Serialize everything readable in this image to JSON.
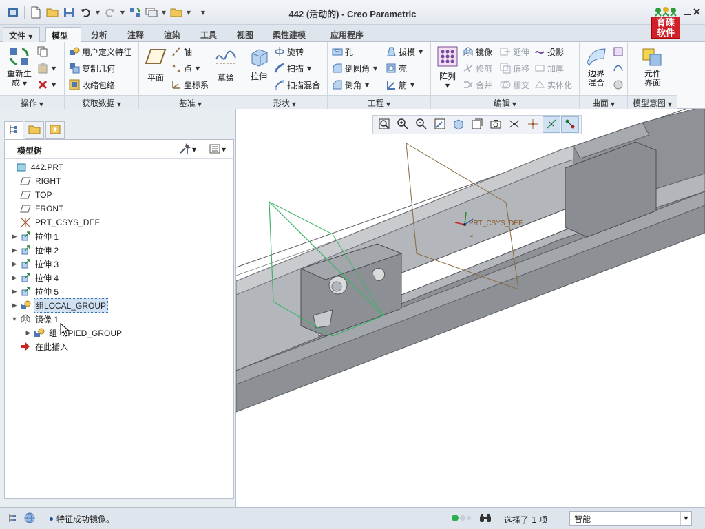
{
  "window": {
    "title": "442 (活动的) - Creo Parametric"
  },
  "logo": {
    "text_line1": "育碟",
    "text_line2": "软件"
  },
  "ribbon_tabs": [
    {
      "label": "文件",
      "dropdown": true
    },
    {
      "label": "模型",
      "active": true
    },
    {
      "label": "分析"
    },
    {
      "label": "注释"
    },
    {
      "label": "渲染"
    },
    {
      "label": "工具"
    },
    {
      "label": "视图"
    },
    {
      "label": "柔性建模"
    },
    {
      "label": "应用程序"
    }
  ],
  "ribbon": {
    "operations": {
      "label": "操作",
      "regenerate_line1": "重新生",
      "regenerate_line2": "成"
    },
    "get_data": {
      "label": "获取数据",
      "user_defined_feature": "用户定义特征",
      "copy_geometry": "复制几何",
      "shrinkwrap": "收缩包络"
    },
    "datum": {
      "label": "基准",
      "plane": "平面",
      "axis": "轴",
      "point": "点",
      "csys": "坐标系",
      "sketch": "草绘"
    },
    "shapes": {
      "label": "形状",
      "extrude": "拉伸",
      "revolve": "旋转",
      "sweep": "扫描",
      "swept_blend": "扫描混合"
    },
    "engineering": {
      "label": "工程",
      "hole": "孔",
      "round": "倒圆角",
      "chamfer": "倒角",
      "draft": "拔模",
      "shell": "壳",
      "rib": "筋"
    },
    "editing": {
      "label": "编辑",
      "pattern": "阵列",
      "mirror": "镜像",
      "trim": "修剪",
      "merge": "合并",
      "extend": "延伸",
      "offset": "偏移",
      "intersect": "相交",
      "project": "投影",
      "thicken": "加厚",
      "solidify": "实体化"
    },
    "surfaces": {
      "label": "曲面",
      "boundary_blend_line1": "边界",
      "boundary_blend_line2": "混合"
    },
    "model_intent": {
      "label": "模型意图",
      "component_interface_line1": "元件",
      "component_interface_line2": "界面"
    }
  },
  "model_tree": {
    "header": "模型树",
    "items": [
      {
        "label": "442.PRT",
        "icon": "part-icon",
        "level": 0,
        "expander": ""
      },
      {
        "label": "RIGHT",
        "icon": "datum-plane-icon",
        "level": 1,
        "expander": ""
      },
      {
        "label": "TOP",
        "icon": "datum-plane-icon",
        "level": 1,
        "expander": ""
      },
      {
        "label": "FRONT",
        "icon": "datum-plane-icon",
        "level": 1,
        "expander": ""
      },
      {
        "label": "PRT_CSYS_DEF",
        "icon": "csys-icon",
        "level": 1,
        "expander": ""
      },
      {
        "label": "拉伸 1",
        "icon": "extrude-icon",
        "level": 1,
        "expander": "▶"
      },
      {
        "label": "拉伸 2",
        "icon": "extrude-icon",
        "level": 1,
        "expander": "▶"
      },
      {
        "label": "拉伸 3",
        "icon": "extrude-icon",
        "level": 1,
        "expander": "▶"
      },
      {
        "label": "拉伸 4",
        "icon": "extrude-icon",
        "level": 1,
        "expander": "▶"
      },
      {
        "label": "拉伸 5",
        "icon": "extrude-icon",
        "level": 1,
        "expander": "▶"
      },
      {
        "label": "组LOCAL_GROUP",
        "icon": "group-icon",
        "level": 1,
        "expander": "▶",
        "selected": true
      },
      {
        "label": "镜像 1",
        "icon": "mirror-icon",
        "level": 1,
        "expander": "▼"
      },
      {
        "label": "组 …PIED_GROUP",
        "icon": "group-icon",
        "level": 2,
        "expander": "▶"
      },
      {
        "label": "在此插入",
        "icon": "insert-here-icon",
        "level": 1,
        "expander": ""
      }
    ]
  },
  "graphics": {
    "csys_label": "PRT_CSYS_DEF",
    "csys_axis_label": "z"
  },
  "status_bar": {
    "message": "特征成功镜像。",
    "selection_info": "选择了 1 项",
    "filter_value": "智能"
  },
  "colors": {
    "accent": "#3a6ea5",
    "logo_red": "#d0202a",
    "model_gray": "#9a9ea3",
    "datum_green": "#3fb56a",
    "datum_brown": "#8a6a3c"
  }
}
